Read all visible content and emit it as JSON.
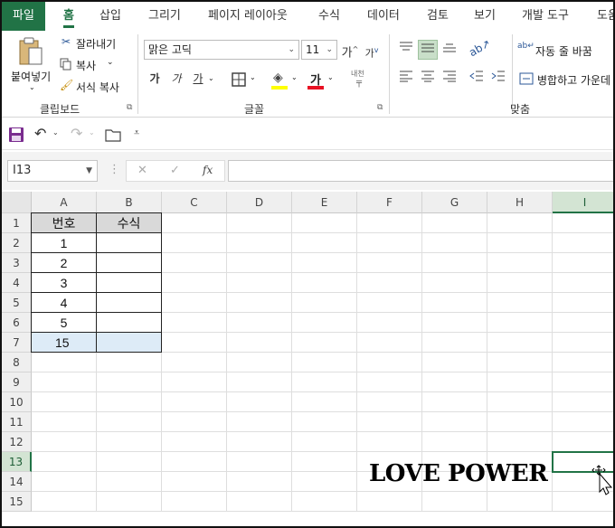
{
  "tabs": [
    {
      "label": "파일",
      "kind": "file"
    },
    {
      "label": "홈",
      "kind": "active"
    },
    {
      "label": "삽입",
      "kind": "normal"
    },
    {
      "label": "그리기",
      "kind": "normal"
    },
    {
      "label": "페이지 레이아웃",
      "kind": "normal"
    },
    {
      "label": "수식",
      "kind": "normal"
    },
    {
      "label": "데이터",
      "kind": "normal"
    },
    {
      "label": "검토",
      "kind": "normal"
    },
    {
      "label": "보기",
      "kind": "normal"
    },
    {
      "label": "개발 도구",
      "kind": "normal"
    },
    {
      "label": "도움",
      "kind": "normal"
    }
  ],
  "ribbon": {
    "clipboard": {
      "paste_label": "붙여넣기",
      "cut_label": "잘라내기",
      "copy_label": "복사",
      "format_painter_label": "서식 복사",
      "group_label": "클립보드"
    },
    "font": {
      "font_name": "맑은 고딕",
      "font_size": "11",
      "grow_font": "가",
      "shrink_font": "가",
      "bold": "가",
      "italic": "가",
      "underline": "가",
      "font_color_glyph": "가",
      "phonetic_glyph": "내천",
      "group_label": "글꼴",
      "font_color": "#e81123",
      "fill_color": "#ffff00"
    },
    "alignment": {
      "wrap_text_label": "자동 줄 바꿈",
      "merge_center_label": "병합하고 가운데",
      "group_label": "맞춤"
    }
  },
  "formula_bar": {
    "name_box": "I13",
    "cancel_glyph": "✕",
    "enter_glyph": "✓",
    "fx_glyph": "fx",
    "formula": ""
  },
  "sheet": {
    "columns": [
      "A",
      "B",
      "C",
      "D",
      "E",
      "F",
      "G",
      "H",
      "I"
    ],
    "rows": [
      "1",
      "2",
      "3",
      "4",
      "5",
      "6",
      "7",
      "8",
      "9",
      "10",
      "11",
      "12",
      "13",
      "14",
      "15"
    ],
    "selected_cell": "I13",
    "headers": {
      "a1": "번호",
      "b1": "수식"
    },
    "numbers": [
      "1",
      "2",
      "3",
      "4",
      "5"
    ],
    "total": "15",
    "header_fill": "#d9d9d9",
    "total_fill": "#ddebf7",
    "overlay_text": "LOVE POWER"
  },
  "colors": {
    "accent": "#217346"
  }
}
